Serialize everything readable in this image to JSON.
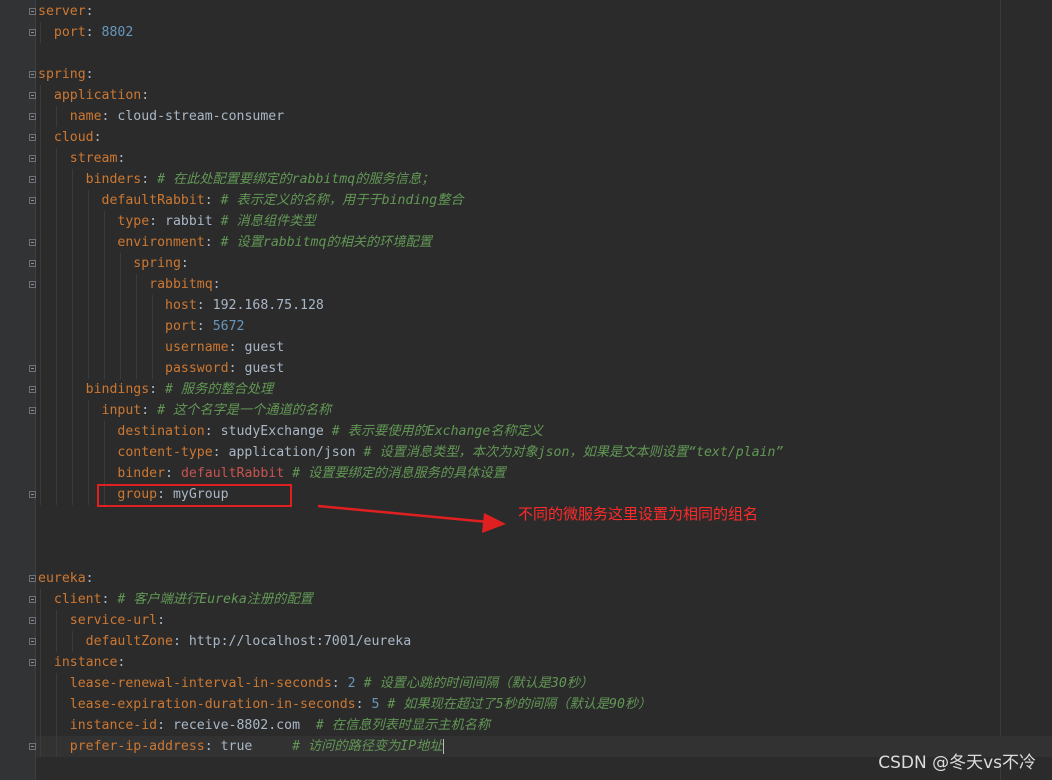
{
  "editor": {
    "lines": [
      [
        {
          "t": "server",
          "c": "k"
        },
        {
          "t": ":",
          "c": "v"
        }
      ],
      [
        {
          "t": "  port",
          "c": "k"
        },
        {
          "t": ": ",
          "c": "v"
        },
        {
          "t": "8802",
          "c": "n"
        }
      ],
      [],
      [
        {
          "t": "spring",
          "c": "k"
        },
        {
          "t": ":",
          "c": "v"
        }
      ],
      [
        {
          "t": "  application",
          "c": "k"
        },
        {
          "t": ":",
          "c": "v"
        }
      ],
      [
        {
          "t": "    name",
          "c": "k"
        },
        {
          "t": ": cloud-stream-consumer",
          "c": "v"
        }
      ],
      [
        {
          "t": "  cloud",
          "c": "k"
        },
        {
          "t": ":",
          "c": "v"
        }
      ],
      [
        {
          "t": "    stream",
          "c": "k"
        },
        {
          "t": ":",
          "c": "v"
        }
      ],
      [
        {
          "t": "      binders",
          "c": "k"
        },
        {
          "t": ": ",
          "c": "v"
        },
        {
          "t": "# 在此处配置要绑定的rabbitmq的服务信息；",
          "c": "c"
        }
      ],
      [
        {
          "t": "        defaultRabbit",
          "c": "k"
        },
        {
          "t": ": ",
          "c": "v"
        },
        {
          "t": "# 表示定义的名称，用于于binding整合",
          "c": "c"
        }
      ],
      [
        {
          "t": "          type",
          "c": "k"
        },
        {
          "t": ": rabbit ",
          "c": "v"
        },
        {
          "t": "# 消息组件类型",
          "c": "c"
        }
      ],
      [
        {
          "t": "          environment",
          "c": "k"
        },
        {
          "t": ": ",
          "c": "v"
        },
        {
          "t": "# 设置rabbitmq的相关的环境配置",
          "c": "c"
        }
      ],
      [
        {
          "t": "            spring",
          "c": "k"
        },
        {
          "t": ":",
          "c": "v"
        }
      ],
      [
        {
          "t": "              rabbitmq",
          "c": "k"
        },
        {
          "t": ":",
          "c": "v"
        }
      ],
      [
        {
          "t": "                host",
          "c": "k"
        },
        {
          "t": ": 192.168.75.128",
          "c": "v"
        }
      ],
      [
        {
          "t": "                port",
          "c": "k"
        },
        {
          "t": ": ",
          "c": "v"
        },
        {
          "t": "5672",
          "c": "n"
        }
      ],
      [
        {
          "t": "                username",
          "c": "k"
        },
        {
          "t": ": guest",
          "c": "v"
        }
      ],
      [
        {
          "t": "                password",
          "c": "k"
        },
        {
          "t": ": guest",
          "c": "v"
        }
      ],
      [
        {
          "t": "      bindings",
          "c": "k"
        },
        {
          "t": ": ",
          "c": "v"
        },
        {
          "t": "# 服务的整合处理",
          "c": "c"
        }
      ],
      [
        {
          "t": "        input",
          "c": "k"
        },
        {
          "t": ": ",
          "c": "v"
        },
        {
          "t": "# 这个名字是一个通道的名称",
          "c": "c"
        }
      ],
      [
        {
          "t": "          destination",
          "c": "k"
        },
        {
          "t": ": studyExchange ",
          "c": "v"
        },
        {
          "t": "# 表示要使用的Exchange名称定义",
          "c": "c"
        }
      ],
      [
        {
          "t": "          content-type",
          "c": "k"
        },
        {
          "t": ": application/json ",
          "c": "v"
        },
        {
          "t": "# 设置消息类型，本次为对象json，如果是文本则设置“text/plain”",
          "c": "c"
        }
      ],
      [
        {
          "t": "          binder",
          "c": "k"
        },
        {
          "t": ": ",
          "c": "v"
        },
        {
          "t": "defaultRabbit",
          "c": "r"
        },
        {
          "t": " ",
          "c": "v"
        },
        {
          "t": "# 设置要绑定的消息服务的具体设置",
          "c": "c"
        }
      ],
      [
        {
          "t": "          group",
          "c": "k"
        },
        {
          "t": ": myGroup",
          "c": "v"
        }
      ],
      [],
      [],
      [],
      [
        {
          "t": "eureka",
          "c": "k"
        },
        {
          "t": ":",
          "c": "v"
        }
      ],
      [
        {
          "t": "  client",
          "c": "k"
        },
        {
          "t": ": ",
          "c": "v"
        },
        {
          "t": "# 客户端进行Eureka注册的配置",
          "c": "c"
        }
      ],
      [
        {
          "t": "    service-url",
          "c": "k"
        },
        {
          "t": ":",
          "c": "v"
        }
      ],
      [
        {
          "t": "      defaultZone",
          "c": "k"
        },
        {
          "t": ": http://localhost:7001/eureka",
          "c": "v"
        }
      ],
      [
        {
          "t": "  instance",
          "c": "k"
        },
        {
          "t": ":",
          "c": "v"
        }
      ],
      [
        {
          "t": "    lease-renewal-interval-in-seconds",
          "c": "k"
        },
        {
          "t": ": ",
          "c": "v"
        },
        {
          "t": "2",
          "c": "n"
        },
        {
          "t": " ",
          "c": "v"
        },
        {
          "t": "# 设置心跳的时间间隔（默认是30秒）",
          "c": "c"
        }
      ],
      [
        {
          "t": "    lease-expiration-duration-in-seconds",
          "c": "k"
        },
        {
          "t": ": ",
          "c": "v"
        },
        {
          "t": "5",
          "c": "n"
        },
        {
          "t": " ",
          "c": "v"
        },
        {
          "t": "# 如果现在超过了5秒的间隔（默认是90秒）",
          "c": "c"
        }
      ],
      [
        {
          "t": "    instance-id",
          "c": "k"
        },
        {
          "t": ": receive-8802.com  ",
          "c": "v"
        },
        {
          "t": "# 在信息列表时显示主机名称",
          "c": "c"
        }
      ],
      [
        {
          "t": "    prefer-ip-address",
          "c": "k"
        },
        {
          "t": ": true     ",
          "c": "v"
        },
        {
          "t": "# 访问的路径变为IP地址",
          "c": "c"
        }
      ]
    ],
    "current_line": 35
  },
  "annotation": {
    "note": "不同的微服务这里设置为相同的组名",
    "color": "#ff2a2a"
  },
  "watermark": "CSDN @冬天vs不冷"
}
